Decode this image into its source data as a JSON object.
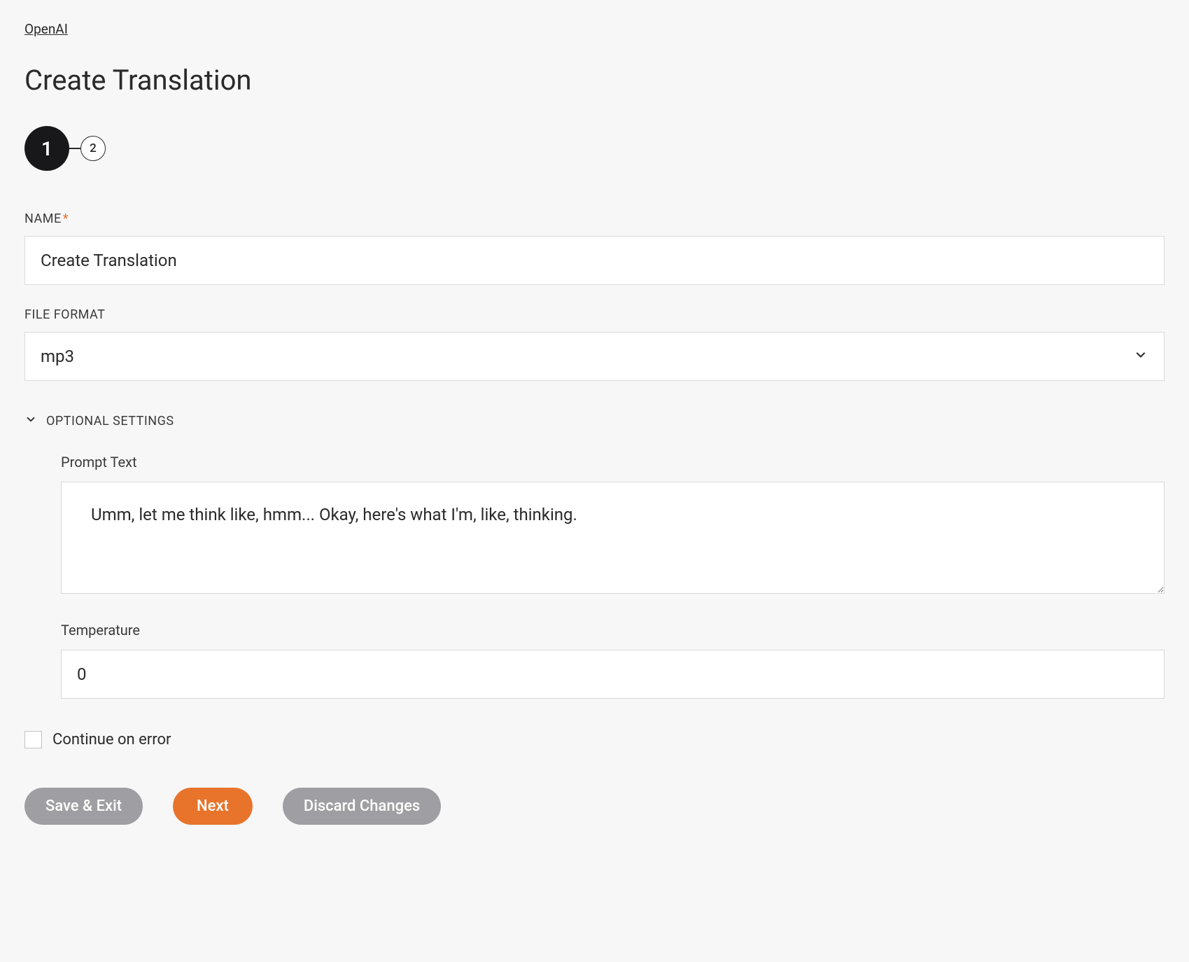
{
  "breadcrumb": "OpenAI",
  "page_title": "Create Translation",
  "stepper": {
    "current": "1",
    "next": "2"
  },
  "form": {
    "name_label": "NAME",
    "name_value": "Create Translation",
    "file_format_label": "FILE FORMAT",
    "file_format_value": "mp3",
    "optional_settings_label": "OPTIONAL SETTINGS",
    "prompt_text_label": "Prompt Text",
    "prompt_text_value": "Umm, let me think like, hmm... Okay, here's what I'm, like, thinking.",
    "temperature_label": "Temperature",
    "temperature_value": "0",
    "continue_on_error_label": "Continue on error"
  },
  "buttons": {
    "save_exit": "Save & Exit",
    "next": "Next",
    "discard": "Discard Changes"
  }
}
